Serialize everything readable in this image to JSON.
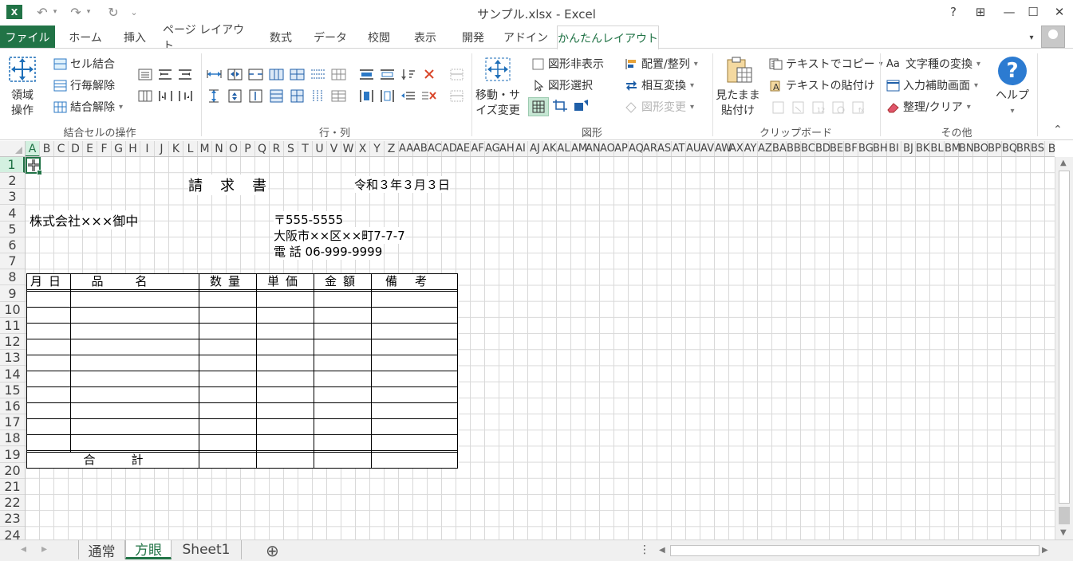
{
  "titlebar": {
    "app_icon_label": "X",
    "document_title": "サンプル.xlsx - Excel",
    "help": "?",
    "restore_ribbon": "⊞",
    "minimize": "—",
    "maximize": "☐",
    "close": "✕",
    "undo": "↶",
    "redo": "↷",
    "refresh": "↻",
    "customize": "⌄"
  },
  "tabs": {
    "file": "ファイル",
    "items": [
      "ホーム",
      "挿入",
      "ページ レイアウト",
      "数式",
      "データ",
      "校閲",
      "表示",
      "開発",
      "アドイン",
      "かんたんレイアウト"
    ]
  },
  "ribbon": {
    "groups": {
      "merge": "結合セルの操作",
      "rowcol": "行・列",
      "shapes": "図形",
      "clipboard": "クリップボード",
      "other": "その他"
    },
    "region_op": [
      "領域",
      "操作"
    ],
    "merge_cells": "セル結合",
    "row_unmerge": "行毎解除",
    "unmerge": "結合解除",
    "move_size": [
      "移動・サ",
      "イズ変更"
    ],
    "hide_shapes": "図形非表示",
    "select_shapes": "図形選択",
    "arrange": "配置/整列",
    "swap": "相互変換",
    "change_shape": "図形変更",
    "paste_as_seen": [
      "見たまま",
      "貼付け"
    ],
    "copy_text": "テキストでコピー",
    "paste_text": "テキストの貼付け",
    "convert_chars": "文字種の変換",
    "input_assist": "入力補助画面",
    "cleanup": "整理/クリア",
    "help": "ヘルプ",
    "collapse": "⌃",
    "accent_color": "#217346"
  },
  "sheet": {
    "columns": [
      "A",
      "B",
      "C",
      "D",
      "E",
      "F",
      "G",
      "H",
      "I",
      "J",
      "K",
      "L",
      "M",
      "N",
      "O",
      "P",
      "Q",
      "R",
      "S",
      "T",
      "U",
      "V",
      "W",
      "X",
      "Y",
      "Z",
      "AA",
      "AB",
      "AC",
      "AD",
      "AE",
      "AF",
      "AG",
      "AH",
      "AI",
      "AJ",
      "AK",
      "AL",
      "AM",
      "AN",
      "AO",
      "AP",
      "AQ",
      "AR",
      "AS",
      "AT",
      "AU",
      "AV",
      "AW",
      "AX",
      "AY",
      "AZ",
      "BA",
      "BB",
      "BC",
      "BD",
      "BE",
      "BF",
      "BG",
      "BH",
      "BI",
      "BJ",
      "BK",
      "BL",
      "BM",
      "BN",
      "BO",
      "BP",
      "BQ",
      "BR",
      "BS",
      "B"
    ],
    "rows": [
      "1",
      "2",
      "3",
      "4",
      "5",
      "6",
      "7",
      "8",
      "9",
      "10",
      "11",
      "12",
      "13",
      "14",
      "15",
      "16",
      "17",
      "18",
      "19",
      "20",
      "21",
      "22",
      "23",
      "24"
    ],
    "title": "請　求　書",
    "date": "令和３年３月３日",
    "addressee": "株式会社×××御中",
    "postal": "〒555-5555",
    "address": "大阪市××区××町7-7-7",
    "phone": "電 話 06-999-9999",
    "table_headers": [
      "月日",
      "品名",
      "数量",
      "単価",
      "金額",
      "備考"
    ],
    "total_label": "合　　　計"
  },
  "sheet_tabs": [
    "通常",
    "方眼",
    "Sheet1"
  ],
  "add_sheet": "⊕",
  "nav": {
    "prev": "◂",
    "next": "▸",
    "more": "⋮"
  }
}
